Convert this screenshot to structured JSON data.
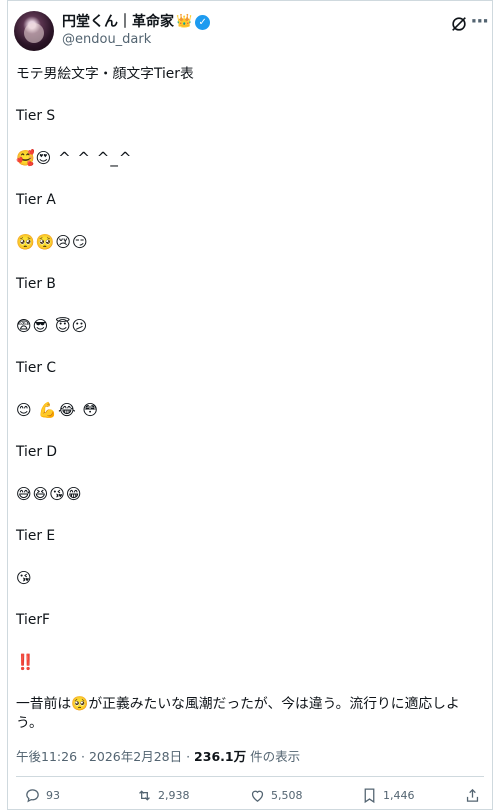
{
  "post": {
    "author": {
      "display_name": "円堂くん｜革命家",
      "handle": "@endou_dark",
      "crown": "👑"
    },
    "lines": [
      "モテ男絵文字・顔文字Tier表",
      "Tier S",
      "🥰😍 ^ ^ ^_^",
      "Tier A",
      "🥺🥺😢😏",
      "Tier B",
      "😨😎 😇😕",
      "Tier C",
      "😊 💪😂 😳",
      "Tier D",
      "😅😆😘😁",
      "Tier E",
      "😘",
      "TierF",
      "‼️"
    ],
    "closing": "一昔前は🥺が正義みたいな風潮だったが、今は違う。流行りに適応しよう。",
    "time": "午後11:26 · 2026年2月28日 · ",
    "views": "236.1万",
    "views_suffix": " 件の表示",
    "actions": {
      "replies": "93",
      "reposts": "2,938",
      "likes": "5,508",
      "bookmarks": "1,446"
    }
  }
}
